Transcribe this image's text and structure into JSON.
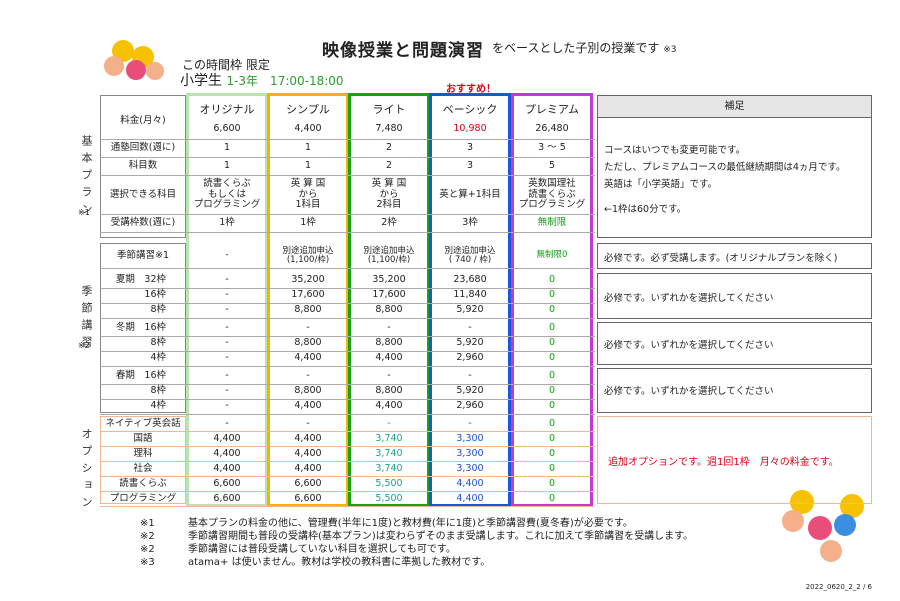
{
  "title": "映像授業と問題演習",
  "subtitle": "をベースとした子別の授業です",
  "subtitle_note": "※3",
  "limit": "この時間枠 限定",
  "grade_prefix": "小学生",
  "grade": "1-3年　17:00-18:00",
  "recommend": "おすすめ！",
  "plans": [
    "オリジナル",
    "シンプル",
    "ライト",
    "ベーシック",
    "プレミアム"
  ],
  "plan_colors": [
    "#b9e3b0",
    "#f5b200",
    "#17a317",
    "#1a55e0",
    "#c23ad6"
  ],
  "side": {
    "basic": "基本プラン",
    "basic_note": "※1",
    "seasonal": "季節講習",
    "seasonal_note": "※2",
    "option": "オプション"
  },
  "hosoku_title": "補足",
  "rows_basic": [
    {
      "label": "料金(月々)",
      "v": [
        "6,600",
        "4,400",
        "7,480",
        "10,980",
        "26,480"
      ]
    },
    {
      "label": "通塾回数(週に)",
      "v": [
        "1",
        "1",
        "2",
        "3",
        "3 ～ 5"
      ]
    },
    {
      "label": "科目数",
      "v": [
        "1",
        "1",
        "2",
        "3",
        "5"
      ]
    },
    {
      "label": "選択できる科目",
      "v": [
        "読書くらぶ\nもしくは\nプログラミング",
        "英 算 国\nから\n1科目",
        "英 算 国\nから\n2科目",
        "英と算+1科目",
        "英数国理社\n読書くらぶ\nプログラミング"
      ]
    },
    {
      "label": "受講枠数(週に)",
      "v": [
        "1枠",
        "1枠",
        "2枠",
        "3枠",
        "無制限"
      ]
    }
  ],
  "hosoku_basic": [
    "コースはいつでも変更可能です。",
    "ただし、プレミアムコースの最低継続期間は4ヵ月です。",
    "英語は「小学英語」です。",
    "←1枠は60分です。"
  ],
  "rows_season": [
    {
      "label": "季節講習※1",
      "v": [
        "-",
        "別途追加申込\n(1,100/枠)",
        "別途追加申込\n(1,100/枠)",
        "別途追加申込\n( 740 / 枠)",
        "無制限0"
      ]
    },
    {
      "label": "夏期　32枠",
      "v": [
        "-",
        "35,200",
        "35,200",
        "23,680",
        "0"
      ]
    },
    {
      "label": "16枠",
      "v": [
        "-",
        "17,600",
        "17,600",
        "11,840",
        "0"
      ]
    },
    {
      "label": "8枠",
      "v": [
        "-",
        "8,800",
        "8,800",
        "5,920",
        "0"
      ]
    },
    {
      "label": "冬期　16枠",
      "v": [
        "-",
        "-",
        "-",
        "-",
        "0"
      ]
    },
    {
      "label": "8枠",
      "v": [
        "-",
        "8,800",
        "8,800",
        "5,920",
        "0"
      ]
    },
    {
      "label": "4枠",
      "v": [
        "-",
        "4,400",
        "4,400",
        "2,960",
        "0"
      ]
    },
    {
      "label": "春期　16枠",
      "v": [
        "-",
        "-",
        "-",
        "-",
        "0"
      ]
    },
    {
      "label": "8枠",
      "v": [
        "-",
        "8,800",
        "8,800",
        "5,920",
        "0"
      ]
    },
    {
      "label": "4枠",
      "v": [
        "-",
        "4,400",
        "4,400",
        "2,960",
        "0"
      ]
    }
  ],
  "hosoku_season": [
    "必修です。必ず受講します。(オリジナルプランを除く)",
    "必修です。いずれかを選択してください",
    "必修です。いずれかを選択してください",
    "必修です。いずれかを選択してください"
  ],
  "rows_option": [
    {
      "label": "ネイティブ英会話",
      "v": [
        "-",
        "-",
        "-",
        "-",
        "0"
      ]
    },
    {
      "label": "国語",
      "v": [
        "4,400",
        "4,400",
        "3,740",
        "3,300",
        "0"
      ]
    },
    {
      "label": "理科",
      "v": [
        "4,400",
        "4,400",
        "3,740",
        "3,300",
        "0"
      ]
    },
    {
      "label": "社会",
      "v": [
        "4,400",
        "4,400",
        "3,740",
        "3,300",
        "0"
      ]
    },
    {
      "label": "読書くらぶ",
      "v": [
        "6,600",
        "6,600",
        "5,500",
        "4,400",
        "0"
      ]
    },
    {
      "label": "プログラミング",
      "v": [
        "6,600",
        "6,600",
        "5,500",
        "4,400",
        "0"
      ]
    }
  ],
  "hosoku_option": "追加オプションです。週1回1枠　月々の料金です。",
  "notes": [
    {
      "k": "※1",
      "t": "基本プランの料金の他に、管理費(半年に1度)と教材費(年に1度)と季節講習費(夏冬春)が必要です。"
    },
    {
      "k": "※2",
      "t": "季節講習期間も普段の受講枠(基本プラン)は変わらずそのまま受講します。これに加えて季節講習を受講します。"
    },
    {
      "k": "※2",
      "t": "季節講習には普段受講していない科目を選択しても可です。"
    },
    {
      "k": "※3",
      "t": "atama+ は使いません。教材は学校の教科書に準拠した教材です。"
    }
  ],
  "footer": "2022_0620_2_2 / 6"
}
